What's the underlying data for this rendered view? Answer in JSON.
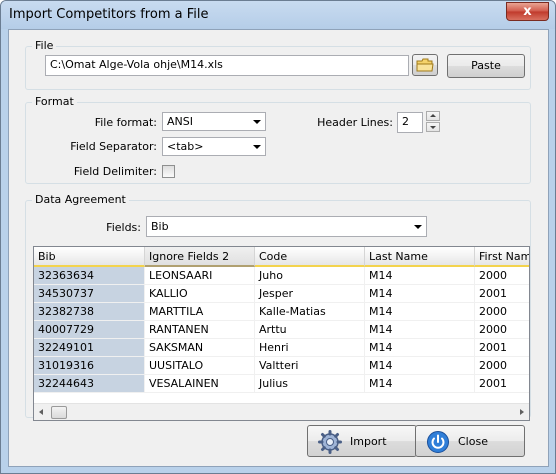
{
  "window": {
    "title": "Import Competitors from a File",
    "close_glyph": "x"
  },
  "file_group": {
    "label": "File",
    "path_value": "C:\\Omat Alge-Vola ohje\\M14.xls",
    "browse_icon": "folder-icon",
    "paste_label": "Paste"
  },
  "format_group": {
    "label": "Format",
    "file_format_label": "File format:",
    "file_format_value": "ANSI",
    "field_separator_label": "Field Separator:",
    "field_separator_value": "<tab>",
    "field_delimiter_label": "Field Delimiter:",
    "field_delimiter_checked": false,
    "header_lines_label": "Header Lines:",
    "header_lines_value": "2"
  },
  "data_group": {
    "label": "Data Agreement",
    "fields_label": "Fields:",
    "fields_value": "Bib",
    "columns": [
      "Bib",
      "Ignore Fields 2",
      "Code",
      "Last Name",
      "First Nam"
    ],
    "rows": [
      [
        "32363634",
        "LEONSAARI",
        "Juho",
        "M14",
        "2000"
      ],
      [
        "34530737",
        "KALLIO",
        "Jesper",
        "M14",
        "2001"
      ],
      [
        "32382738",
        "MARTTILA",
        "Kalle-Matias",
        "M14",
        "2000"
      ],
      [
        "40007729",
        "RANTANEN",
        "Arttu",
        "M14",
        "2000"
      ],
      [
        "32249101",
        "SAKSMAN",
        "Henri",
        "M14",
        "2001"
      ],
      [
        "31019316",
        "UUSITALO",
        "Valtteri",
        "M14",
        "2000"
      ],
      [
        "32244643",
        "VESALAINEN",
        "Julius",
        "M14",
        "2001"
      ]
    ]
  },
  "footer": {
    "import_label": "Import",
    "import_icon": "gear-icon",
    "close_label": "Close",
    "close_icon": "power-icon"
  }
}
